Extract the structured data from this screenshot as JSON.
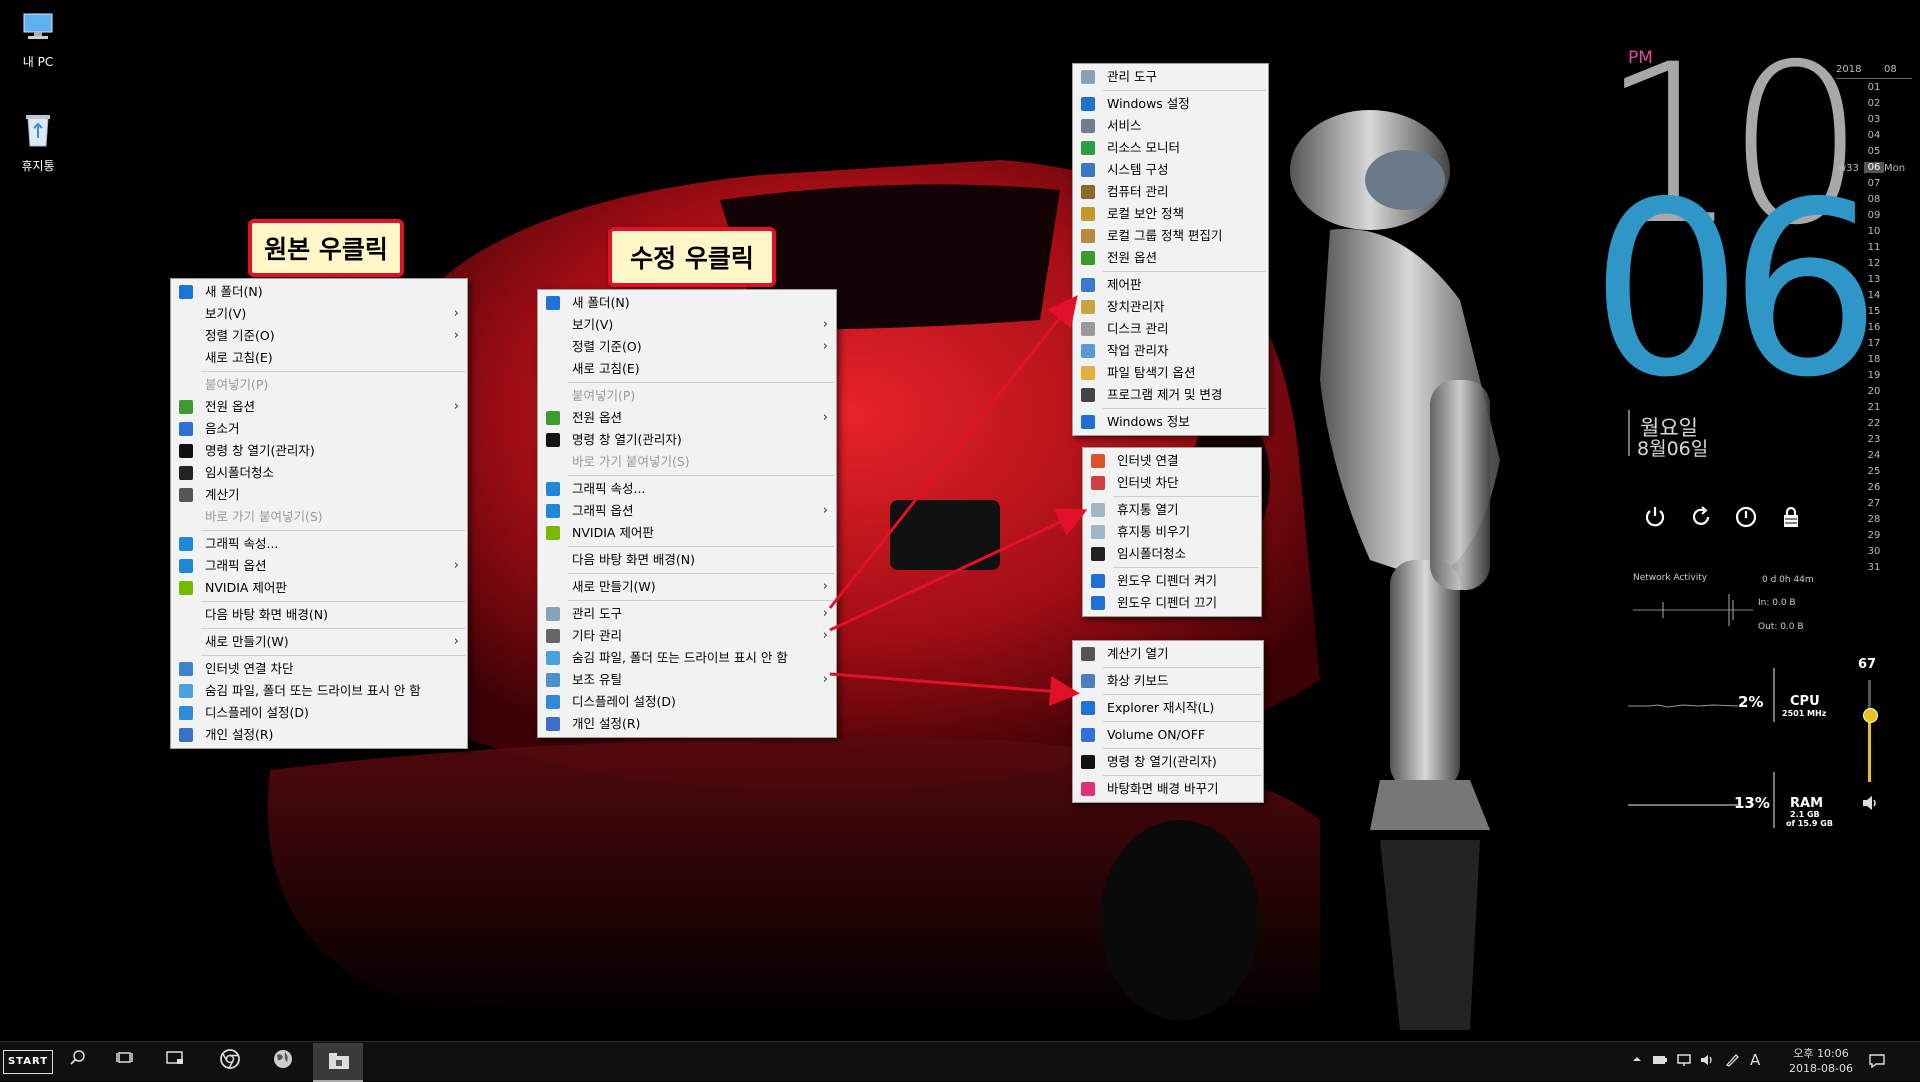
{
  "desktop": {
    "icons": [
      {
        "label": "내 PC",
        "icon": "computer-icon"
      },
      {
        "label": "휴지통",
        "icon": "recycle-bin-icon"
      }
    ]
  },
  "callouts": {
    "original": "원본 우클릭",
    "modified": "수정 우클릭"
  },
  "menu_original": {
    "items": [
      {
        "label": "새 폴더(N)",
        "icon": "new-folder-icon"
      },
      {
        "label": "보기(V)",
        "submenu": true
      },
      {
        "label": "정렬 기준(O)",
        "submenu": true
      },
      {
        "label": "새로 고침(E)"
      },
      {
        "sep": true
      },
      {
        "label": "붙여넣기(P)",
        "disabled": true
      },
      {
        "label": "전원 옵션",
        "icon": "power-options-icon",
        "submenu": true
      },
      {
        "label": "음소거",
        "icon": "speaker-icon"
      },
      {
        "label": "명령 창 열기(관리자)",
        "icon": "cmd-icon"
      },
      {
        "label": "임시폴더청소",
        "icon": "trash-icon"
      },
      {
        "label": "계산기",
        "icon": "calculator-icon"
      },
      {
        "label": "바로 가기 붙여넣기(S)",
        "disabled": true
      },
      {
        "sep": true
      },
      {
        "label": "그래픽 속성...",
        "icon": "graphics-icon"
      },
      {
        "label": "그래픽 옵션",
        "icon": "graphics-icon",
        "submenu": true
      },
      {
        "label": "NVIDIA 제어판",
        "icon": "nvidia-icon"
      },
      {
        "sep": true
      },
      {
        "label": "다음 바탕 화면 배경(N)"
      },
      {
        "sep": true
      },
      {
        "label": "새로 만들기(W)",
        "submenu": true
      },
      {
        "sep": true
      },
      {
        "label": "인터넷 연결 차단",
        "icon": "network-icon"
      },
      {
        "label": "숨김 파일, 폴더 또는 드라이브 표시 안 함",
        "icon": "hidden-files-icon"
      },
      {
        "label": "디스플레이 설정(D)",
        "icon": "display-icon"
      },
      {
        "label": "개인 설정(R)",
        "icon": "personalize-icon"
      }
    ]
  },
  "menu_modified": {
    "items": [
      {
        "label": "새 폴더(N)",
        "icon": "new-folder-icon"
      },
      {
        "label": "보기(V)",
        "submenu": true
      },
      {
        "label": "정렬 기준(O)",
        "submenu": true
      },
      {
        "label": "새로 고침(E)"
      },
      {
        "sep": true
      },
      {
        "label": "붙여넣기(P)",
        "disabled": true
      },
      {
        "label": "전원 옵션",
        "icon": "power-options-icon",
        "submenu": true
      },
      {
        "label": "명령 창 열기(관리자)",
        "icon": "cmd-icon"
      },
      {
        "label": "바로 가기 붙여넣기(S)",
        "disabled": true
      },
      {
        "sep": true
      },
      {
        "label": "그래픽 속성...",
        "icon": "graphics-icon"
      },
      {
        "label": "그래픽 옵션",
        "icon": "graphics-icon",
        "submenu": true
      },
      {
        "label": "NVIDIA 제어판",
        "icon": "nvidia-icon"
      },
      {
        "sep": true
      },
      {
        "label": "다음 바탕 화면 배경(N)"
      },
      {
        "sep": true
      },
      {
        "label": "새로 만들기(W)",
        "submenu": true
      },
      {
        "sep": true
      },
      {
        "label": "관리 도구",
        "icon": "admin-tools-icon",
        "submenu": true
      },
      {
        "label": "기타 관리",
        "icon": "user-icon",
        "submenu": true
      },
      {
        "label": "숨김 파일, 폴더 또는 드라이브 표시 안 함",
        "icon": "hidden-files-icon"
      },
      {
        "label": "보조 유틸",
        "icon": "utility-icon",
        "submenu": true
      },
      {
        "label": "디스플레이 설정(D)",
        "icon": "display-icon"
      },
      {
        "label": "개인 설정(R)",
        "icon": "personalize-icon"
      }
    ]
  },
  "submenu_admin": {
    "items": [
      {
        "label": "관리 도구",
        "icon": "admin-tools-icon"
      },
      {
        "sep": true
      },
      {
        "label": "Windows 설정",
        "icon": "gear-icon"
      },
      {
        "label": "서비스",
        "icon": "services-icon"
      },
      {
        "label": "리소스 모니터",
        "icon": "resource-monitor-icon"
      },
      {
        "label": "시스템 구성",
        "icon": "system-config-icon"
      },
      {
        "label": "컴퓨터 관리",
        "icon": "computer-management-icon"
      },
      {
        "label": "로컬 보안 정책",
        "icon": "security-policy-icon"
      },
      {
        "label": "로컬 그룹 정책 편집기",
        "icon": "group-policy-icon"
      },
      {
        "label": "전원 옵션",
        "icon": "power-options-icon"
      },
      {
        "sep": true
      },
      {
        "label": "제어판",
        "icon": "control-panel-icon"
      },
      {
        "label": "장치관리자",
        "icon": "device-manager-icon"
      },
      {
        "label": "디스크 관리",
        "icon": "disk-icon"
      },
      {
        "label": "작업 관리자",
        "icon": "task-manager-icon"
      },
      {
        "label": "파일 탐색기 옵션",
        "icon": "folder-options-icon"
      },
      {
        "label": "프로그램 제거 및 변경",
        "icon": "programs-icon"
      },
      {
        "sep": true
      },
      {
        "label": "Windows 정보",
        "icon": "info-icon"
      }
    ]
  },
  "submenu_misc": {
    "items": [
      {
        "label": "인터넷 연결",
        "icon": "internet-icon"
      },
      {
        "label": "인터넷 차단",
        "icon": "internet-block-icon"
      },
      {
        "sep": true
      },
      {
        "label": "휴지통 열기",
        "icon": "recycle-bin-icon"
      },
      {
        "label": "휴지통 비우기",
        "icon": "recycle-bin-icon"
      },
      {
        "label": "임시폴더청소",
        "icon": "trash-icon"
      },
      {
        "sep": true
      },
      {
        "label": "윈도우 디펜더 켜기",
        "icon": "defender-icon"
      },
      {
        "label": "윈도우 디펜더 끄기",
        "icon": "defender-icon"
      }
    ]
  },
  "submenu_util": {
    "items": [
      {
        "label": "계산기 열기",
        "icon": "calculator-icon"
      },
      {
        "sep": true
      },
      {
        "label": "화상 키보드",
        "icon": "keyboard-icon"
      },
      {
        "sep": true
      },
      {
        "label": "Explorer 재시작(L)",
        "icon": "refresh-icon"
      },
      {
        "sep": true
      },
      {
        "label": "Volume ON/OFF",
        "icon": "speaker-icon"
      },
      {
        "sep": true
      },
      {
        "label": "명령 창 열기(관리자)",
        "icon": "cmd-icon"
      },
      {
        "sep": true
      },
      {
        "label": "바탕화면 배경 바꾸기",
        "icon": "wallpaper-icon"
      }
    ]
  },
  "clock": {
    "ampm": "PM",
    "hour": "10",
    "minute": "06",
    "day_name": "월요일",
    "date": "8월06일"
  },
  "calendar": {
    "year": "2018",
    "month": "08",
    "week": "w33",
    "weekday": "Mon",
    "today": "06",
    "days": [
      "01",
      "02",
      "03",
      "04",
      "05",
      "06",
      "07",
      "08",
      "09",
      "10",
      "11",
      "12",
      "13",
      "14",
      "15",
      "16",
      "17",
      "18",
      "19",
      "20",
      "21",
      "22",
      "23",
      "24",
      "25",
      "26",
      "27",
      "28",
      "29",
      "30",
      "31"
    ]
  },
  "power_buttons": [
    {
      "name": "shutdown",
      "icon": "power-icon"
    },
    {
      "name": "restart",
      "icon": "restart-icon"
    },
    {
      "name": "hibernate",
      "icon": "hibernate-icon"
    },
    {
      "name": "lock",
      "icon": "lock-icon"
    }
  ],
  "network": {
    "title": "Network Activity",
    "uptime": "0 d 0h 44m",
    "in": "In: 0.0 B",
    "out": "Out: 0.0 B"
  },
  "cpu": {
    "percent": "2%",
    "label": "CPU",
    "sub": "2501 MHz"
  },
  "ram": {
    "percent": "13%",
    "label": "RAM",
    "sub1": "2.1 GB",
    "sub2": "of 15.9 GB"
  },
  "volume": {
    "value": "67",
    "level": 0.67
  },
  "taskbar": {
    "start_label": "START",
    "time": "오후 10:06",
    "date": "2018-08-06",
    "ime": "A"
  },
  "colors": {
    "callout_border": "#e3102a",
    "callout_bg": "#fff7c8",
    "clock_minute": "#2f97c8",
    "clock_hour": "#a8a8a8",
    "arrow": "#e3102a"
  }
}
